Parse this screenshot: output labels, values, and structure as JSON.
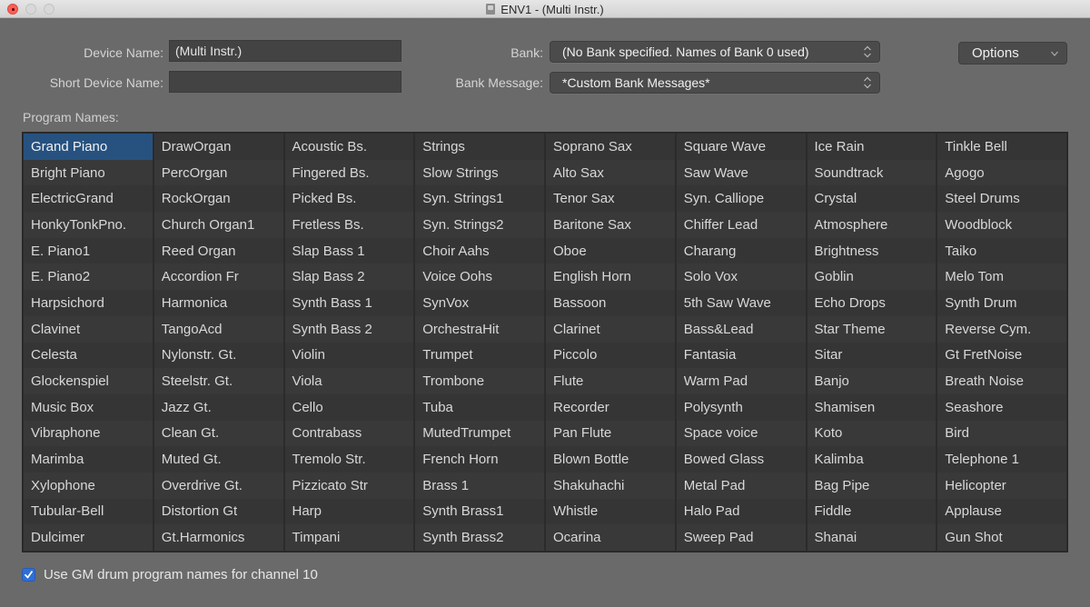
{
  "window": {
    "title": "ENV1 - (Multi Instr.)"
  },
  "device": {
    "device_name_label": "Device Name:",
    "device_name_value": "(Multi Instr.)",
    "short_device_name_label": "Short Device Name:",
    "short_device_name_value": ""
  },
  "bank": {
    "bank_label": "Bank:",
    "bank_value": "(No Bank specified. Names of Bank 0 used)",
    "bank_message_label": "Bank Message:",
    "bank_message_value": "*Custom Bank Messages*"
  },
  "options_label": "Options",
  "program_names_label": "Program Names:",
  "selected_program": "Grand Piano",
  "colors": {
    "selection": "#27527f",
    "checkbox": "#2e6fd8"
  },
  "programs": [
    [
      "Grand Piano",
      "Bright Piano",
      "ElectricGrand",
      "HonkyTonkPno.",
      "E. Piano1",
      "E. Piano2",
      "Harpsichord",
      "Clavinet",
      "Celesta",
      "Glockenspiel",
      "Music Box",
      "Vibraphone",
      "Marimba",
      "Xylophone",
      "Tubular-Bell",
      "Dulcimer"
    ],
    [
      "DrawOrgan",
      "PercOrgan",
      "RockOrgan",
      "Church Organ1",
      "Reed Organ",
      "Accordion Fr",
      "Harmonica",
      "TangoAcd",
      "Nylonstr. Gt.",
      "Steelstr. Gt.",
      "Jazz Gt.",
      "Clean Gt.",
      "Muted Gt.",
      "Overdrive Gt.",
      "Distortion Gt",
      "Gt.Harmonics"
    ],
    [
      "Acoustic Bs.",
      "Fingered Bs.",
      "Picked Bs.",
      "Fretless Bs.",
      "Slap Bass 1",
      "Slap Bass 2",
      "Synth Bass 1",
      "Synth Bass 2",
      "Violin",
      "Viola",
      "Cello",
      "Contrabass",
      "Tremolo Str.",
      "Pizzicato Str",
      "Harp",
      "Timpani"
    ],
    [
      "Strings",
      "Slow Strings",
      "Syn. Strings1",
      "Syn. Strings2",
      "Choir Aahs",
      "Voice Oohs",
      "SynVox",
      "OrchestraHit",
      "Trumpet",
      "Trombone",
      "Tuba",
      "MutedTrumpet",
      "French Horn",
      "Brass 1",
      "Synth Brass1",
      "Synth Brass2"
    ],
    [
      "Soprano Sax",
      "Alto Sax",
      "Tenor Sax",
      "Baritone Sax",
      "Oboe",
      "English Horn",
      "Bassoon",
      "Clarinet",
      "Piccolo",
      "Flute",
      "Recorder",
      "Pan Flute",
      "Blown Bottle",
      "Shakuhachi",
      "Whistle",
      "Ocarina"
    ],
    [
      "Square Wave",
      "Saw Wave",
      "Syn. Calliope",
      "Chiffer Lead",
      "Charang",
      "Solo Vox",
      "5th Saw Wave",
      "Bass&Lead",
      "Fantasia",
      "Warm Pad",
      "Polysynth",
      "Space voice",
      "Bowed Glass",
      "Metal Pad",
      "Halo Pad",
      "Sweep Pad"
    ],
    [
      "Ice Rain",
      "Soundtrack",
      "Crystal",
      "Atmosphere",
      "Brightness",
      "Goblin",
      "Echo Drops",
      "Star Theme",
      "Sitar",
      "Banjo",
      "Shamisen",
      "Koto",
      "Kalimba",
      "Bag Pipe",
      "Fiddle",
      "Shanai"
    ],
    [
      "Tinkle Bell",
      "Agogo",
      "Steel Drums",
      "Woodblock",
      "Taiko",
      "Melo Tom",
      "Synth Drum",
      "Reverse Cym.",
      "Gt FretNoise",
      "Breath Noise",
      "Seashore",
      "Bird",
      "Telephone 1",
      "Helicopter",
      "Applause",
      "Gun Shot"
    ]
  ],
  "gm_drum_checkbox": {
    "label": "Use GM drum program names for channel 10",
    "checked": true
  }
}
